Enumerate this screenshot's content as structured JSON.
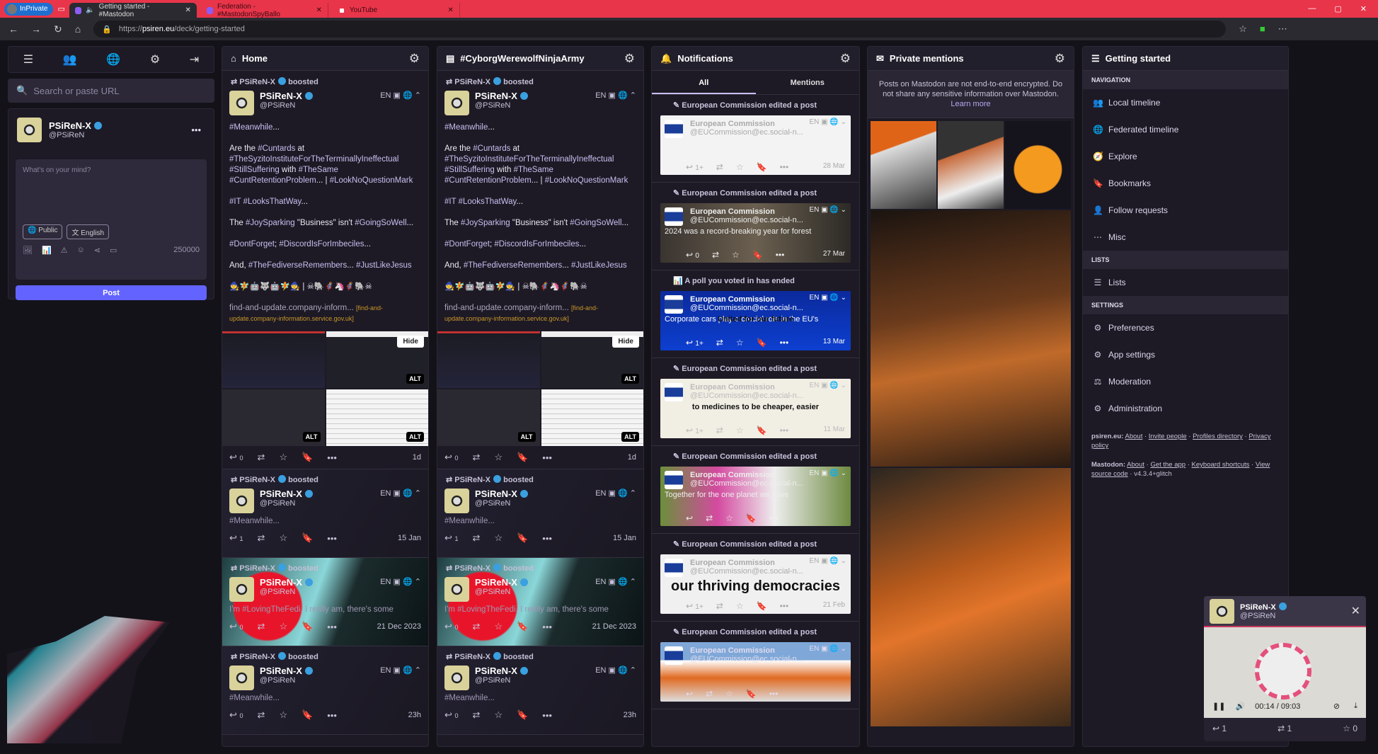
{
  "browser": {
    "inprivate_label": "InPrivate",
    "tabs": [
      {
        "title": "Getting started - #Mastodon",
        "active": true
      },
      {
        "title": "Federation - #MastodonSpyBallo",
        "active": false
      },
      {
        "title": "YouTube",
        "active": false
      }
    ],
    "url_prefix": "https://",
    "url_host": "psiren.eu",
    "url_path": "/deck/getting-started"
  },
  "compose": {
    "search_placeholder": "Search or paste URL",
    "user_name": "PSiReN-X",
    "user_handle": "@PSiReN",
    "placeholder": "What's on your mind?",
    "visibility": "Public",
    "language": "English",
    "char_count": "250000",
    "post_label": "Post"
  },
  "columns": {
    "home": "Home",
    "hashtag": "#CyborgWerewolfNinjaArmy",
    "notifications": "Notifications",
    "private_mentions": "Private mentions",
    "getting_started": "Getting started"
  },
  "timeline": {
    "boosted_label": "boosted",
    "lang": "EN",
    "main_post": {
      "booster": "PSiReN-X",
      "name": "PSiReN-X",
      "handle": "@PSiReN",
      "paragraphs": [
        "#Meanwhile...",
        "Are the #Cuntards at #TheSyzitoInstituteForTheTerminallyIneffectual #StillSuffering with #TheSame #CuntRetentionProblem... | #LookNoQuestionMark",
        "#IT #LooksThatWay...",
        "The #JoySparking \"Business\" isn't #GoingSoWell...",
        "#DontForget; #DiscordIsForImbeciles...",
        "And, #TheFediverseRemembers... #JustLikeJesus",
        "🧙🧚🤖🐺🤖🧚🧙 | ☠🐘🦸🦄🦸🐘☠"
      ],
      "link_text": "find-and-update.company-inform...",
      "link_domain": "[find-and-update.company-information.service.gov.uk]",
      "hide_label": "Hide",
      "alt_label": "ALT",
      "replies": "0",
      "time": "1d"
    },
    "compact_posts": [
      {
        "booster": "PSiReN-X",
        "name": "PSiReN-X",
        "handle": "@PSiReN",
        "text": "#Meanwhile...",
        "replies": "1",
        "time": "15 Jan"
      },
      {
        "booster": "PSiReN-X",
        "name": "PSiReN-X",
        "handle": "@PSiReN",
        "text": "I'm #LovingTheFedi, I really am, there's some",
        "replies": "0",
        "time": "21 Dec 2023"
      },
      {
        "booster": "PSiReN-X",
        "name": "PSiReN-X",
        "handle": "@PSiReN",
        "text": "#Meanwhile...",
        "replies": "0",
        "time": "23h"
      }
    ]
  },
  "notifications": {
    "tabs": [
      "All",
      "Mentions"
    ],
    "items": [
      {
        "title": "European Commission edited a post",
        "icon": "pencil",
        "name": "European Commission",
        "handle": "@EUCommission@ec.social-n...",
        "text": "",
        "overlay": "",
        "replies": "1+",
        "date": "28 Mar",
        "style": "c1"
      },
      {
        "title": "European Commission edited a post",
        "icon": "pencil",
        "name": "European Commission",
        "handle": "@EUCommission@ec.social-n...",
        "text": "2024 was a record-breaking year for forest",
        "overlay": "",
        "replies": "0",
        "date": "27 Mar",
        "style": "c2"
      },
      {
        "title": "A poll you voted in has ended",
        "icon": "poll",
        "name": "European Commission",
        "handle": "@EUCommission@ec.social-n...",
        "text": "Corporate cars play a crucial role in the EU's",
        "overlay": "United for our future",
        "replies": "1+",
        "date": "13 Mar",
        "style": "c3"
      },
      {
        "title": "European Commission edited a post",
        "icon": "pencil",
        "name": "European Commission",
        "handle": "@EUCommission@ec.social-n...",
        "text": "",
        "overlay": "to medicines to be cheaper, easier",
        "replies": "1+",
        "date": "11 Mar",
        "style": "c4"
      },
      {
        "title": "European Commission edited a post",
        "icon": "pencil",
        "name": "European Commission",
        "handle": "@EUCommission@ec.social-n...",
        "text": "Together for the one planet we have",
        "overlay": "",
        "replies": "",
        "date": "",
        "style": "c5"
      },
      {
        "title": "European Commission edited a post",
        "icon": "pencil",
        "name": "European Commission",
        "handle": "@EUCommission@ec.social-n...",
        "text": "",
        "overlay": "our thriving democracies",
        "replies": "1+",
        "date": "21 Feb",
        "style": "c6"
      },
      {
        "title": "European Commission edited a post",
        "icon": "pencil",
        "name": "European Commission",
        "handle": "@EUCommission@ec.social-n...",
        "text": "",
        "overlay": "",
        "replies": "",
        "date": "",
        "style": "c7"
      }
    ]
  },
  "private_mentions": {
    "notice": "Posts on Mastodon are not end-to-end encrypted. Do not share any sensitive information over Mastodon.",
    "learn_more": "Learn more"
  },
  "getting_started": {
    "sections": [
      {
        "title": "Navigation",
        "items": [
          {
            "label": "Local timeline",
            "icon": "👥"
          },
          {
            "label": "Federated timeline",
            "icon": "🌐"
          },
          {
            "label": "Explore",
            "icon": "🧭"
          },
          {
            "label": "Bookmarks",
            "icon": "🔖"
          },
          {
            "label": "Follow requests",
            "icon": "👤"
          },
          {
            "label": "Misc",
            "icon": "⋯"
          }
        ]
      },
      {
        "title": "Lists",
        "items": [
          {
            "label": "Lists",
            "icon": "☰"
          }
        ]
      },
      {
        "title": "Settings",
        "items": [
          {
            "label": "Preferences",
            "icon": "⚙"
          },
          {
            "label": "App settings",
            "icon": "⚙"
          },
          {
            "label": "Moderation",
            "icon": "⚖"
          },
          {
            "label": "Administration",
            "icon": "⚙"
          }
        ]
      }
    ],
    "footer": {
      "site": "psiren.eu:",
      "site_links": [
        "About",
        "Invite people",
        "Profiles directory",
        "Privacy policy"
      ],
      "mastodon": "Mastodon:",
      "mastodon_links": [
        "About",
        "Get the app",
        "Keyboard shortcuts",
        "View source code"
      ],
      "version": "v4.3.4+glitch"
    }
  },
  "player": {
    "name": "PSiReN-X",
    "handle": "@PSiReN",
    "current_time": "00:14",
    "duration": "09:03",
    "progress_fraction": 0.026,
    "replies": "1",
    "boosts": "1",
    "favourites": "0"
  }
}
